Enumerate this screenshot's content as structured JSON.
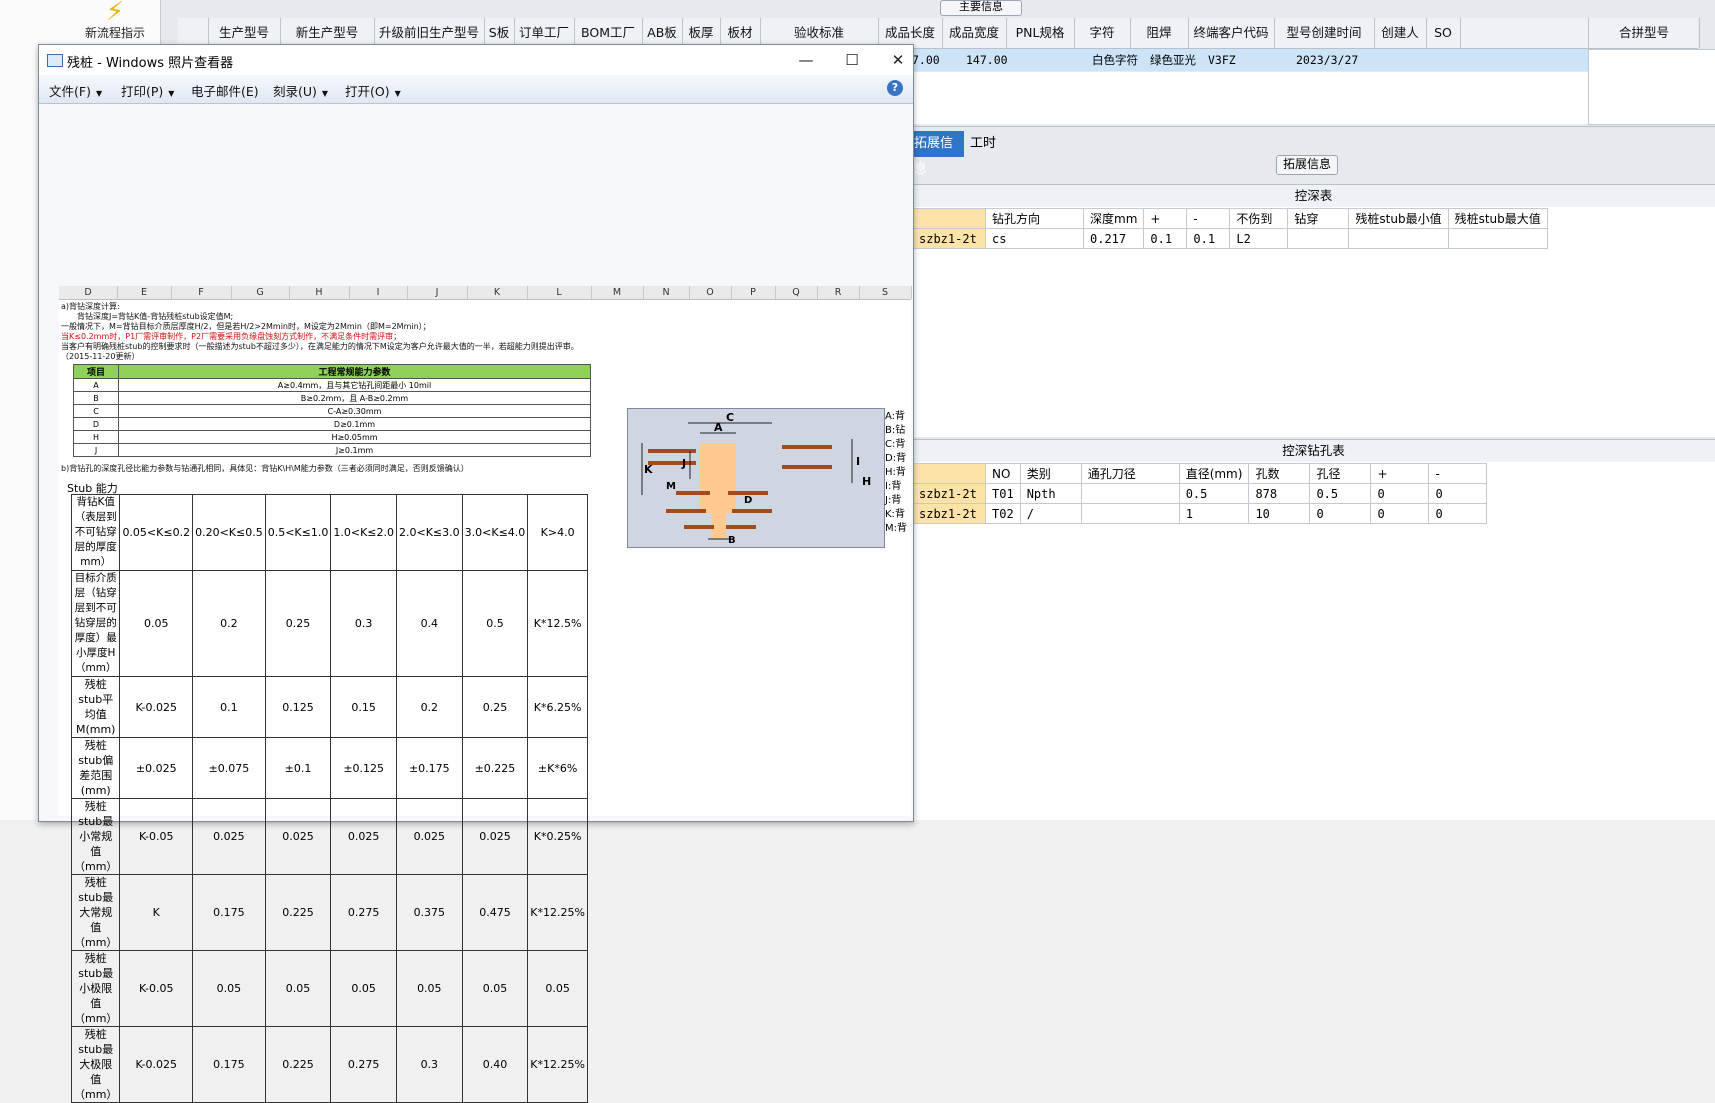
{
  "sidebar": {
    "new_flow": "新流程指示"
  },
  "main_header": {
    "main_info_tab": "主要信息",
    "merge_col": "合拼型号",
    "columns": [
      "生产型号",
      "新生产型号",
      "升级前旧生产型号",
      "S板",
      "订单工厂",
      "BOM工厂",
      "AB板",
      "板厚",
      "板材",
      "验收标准",
      "成品长度",
      "成品宽度",
      "PNL规格",
      "字符",
      "阻焊",
      "终端客户代码",
      "型号创建时间",
      "创建人",
      "SO"
    ],
    "row": {
      "length": "7.00",
      "width": "147.00",
      "char": "白色字符",
      "mask": "绿色亚光",
      "customer": "V3FZ",
      "created": "2023/3/27"
    }
  },
  "tabs": {
    "ext_info": "拓展信息",
    "hours": "工时",
    "ext_btn": "拓展信息"
  },
  "depth_table": {
    "title": "控深表",
    "headers": [
      "钻孔方向",
      "深度mm",
      "+",
      "-",
      "不伤到",
      "钻穿",
      "残桩stub最小值",
      "残桩stub最大值"
    ],
    "row": {
      "name": "szbz1-2t",
      "dir": "cs",
      "depth": "0.217",
      "plus": "0.1",
      "minus": "0.1",
      "layer": "L2",
      "thru": "",
      "min": "",
      "max": ""
    }
  },
  "drill_table": {
    "title": "控深钻孔表",
    "headers": [
      "NO",
      "类别",
      "通孔刀径",
      "直径(mm)",
      "孔数",
      "孔径",
      "+",
      "-"
    ],
    "rows": [
      {
        "name": "szbz1-2t",
        "no": "T01",
        "type": "Npth",
        "tool": "",
        "dia": "0.5",
        "count": "878",
        "hole": "0.5",
        "plus": "0",
        "minus": "0"
      },
      {
        "name": "szbz1-2t",
        "no": "T02",
        "type": "/",
        "tool": "",
        "dia": "1",
        "count": "10",
        "hole": "0",
        "plus": "0",
        "minus": "0"
      }
    ]
  },
  "viewer": {
    "title": "残桩 - Windows 照片查看器",
    "menu": [
      "文件(F)",
      "打印(P)",
      "电子邮件(E)",
      "刻录(U)",
      "打开(O)"
    ],
    "help": "?",
    "btn_min": "—",
    "btn_max": "☐",
    "btn_close": "✕"
  },
  "sheet": {
    "cols": [
      "D",
      "E",
      "F",
      "G",
      "H",
      "I",
      "J",
      "K",
      "L",
      "M",
      "N",
      "O",
      "P",
      "Q",
      "R",
      "S"
    ],
    "notes": [
      "a)背钻深度计算:",
      "背钻深度J=背钻K值-背钻残桩stub设定值M;",
      "一般情况下，M=背钻目标介质层厚度H/2，但是若H/2>2Mmin时，M设定为2Mmin（即M=2Mmin）；",
      "当K≤0.2mm时，P1厂需评审制作，P2厂需要采用负缘盘蚀刻方式制作，不满足条件时需评审；",
      "当客户有明确残桩stub的控制要求时（一般描述为stub不超过多少），在满足能力的情况下M设定为客户允许最大值的一半，若超能力则提出评审。（2015-11-20更新）"
    ],
    "cap_title": [
      "项目",
      "工程常规能力参数"
    ],
    "cap_rows": [
      [
        "A",
        "A≥0.4mm，且与其它钻孔间距最小 10mil"
      ],
      [
        "B",
        "B≥0.2mm，且 A-B≥0.2mm"
      ],
      [
        "C",
        "C-A≥0.30mm"
      ],
      [
        "D",
        "D≥0.1mm"
      ],
      [
        "H",
        "H≥0.05mm"
      ],
      [
        "J",
        "J≥0.1mm"
      ]
    ],
    "note_b": "b)背钻孔的深度孔径比能力参数与钻通孔相同，具体见：背钻K\\H\\M能力参数（三者必须同时满足，否则反馈确认）",
    "stub_title": "Stub 能力",
    "stub_rows": [
      [
        "背钻K值（表层到不可钻穿层的厚度mm）",
        "0.05<K≤0.2",
        "0.20<K≤0.5",
        "0.5<K≤1.0",
        "1.0<K≤2.0",
        "2.0<K≤3.0",
        "3.0<K≤4.0",
        "K>4.0"
      ],
      [
        "目标介质层（钻穿层到不可钻穿层的厚度）最小厚度H（mm）",
        "0.05",
        "0.2",
        "0.25",
        "0.3",
        "0.4",
        "0.5",
        "K*12.5%"
      ],
      [
        "残桩stub平均值M(mm)",
        "K-0.025",
        "0.1",
        "0.125",
        "0.15",
        "0.2",
        "0.25",
        "K*6.25%"
      ],
      [
        "残桩stub偏差范围(mm)",
        "±0.025",
        "±0.075",
        "±0.1",
        "±0.125",
        "±0.175",
        "±0.225",
        "±K*6%"
      ],
      [
        "残桩stub最小常规值（mm）",
        "K-0.05",
        "0.025",
        "0.025",
        "0.025",
        "0.025",
        "0.025",
        "K*0.25%"
      ],
      [
        "残桩stub最大常规值（mm）",
        "K",
        "0.175",
        "0.225",
        "0.275",
        "0.375",
        "0.475",
        "K*12.25%"
      ],
      [
        "残桩stub最小极限值（mm）",
        "K-0.05",
        "0.05",
        "0.05",
        "0.05",
        "0.05",
        "0.05",
        "0.05"
      ],
      [
        "残桩stub最大极限值（mm）",
        "K-0.025",
        "0.175",
        "0.225",
        "0.275",
        "0.3",
        "0.40",
        "K*12.25%"
      ]
    ],
    "diagram_labels": [
      "C",
      "A",
      "K",
      "J",
      "I",
      "H",
      "M",
      "D",
      "B"
    ],
    "legend": [
      "A:",
      "B:",
      "C:",
      "D:",
      "H:",
      "I:",
      "J:",
      "K:",
      "M:"
    ],
    "legend_text": [
      "背",
      "钻",
      "背",
      "背",
      "背",
      "背",
      "背",
      "背",
      "背"
    ]
  }
}
